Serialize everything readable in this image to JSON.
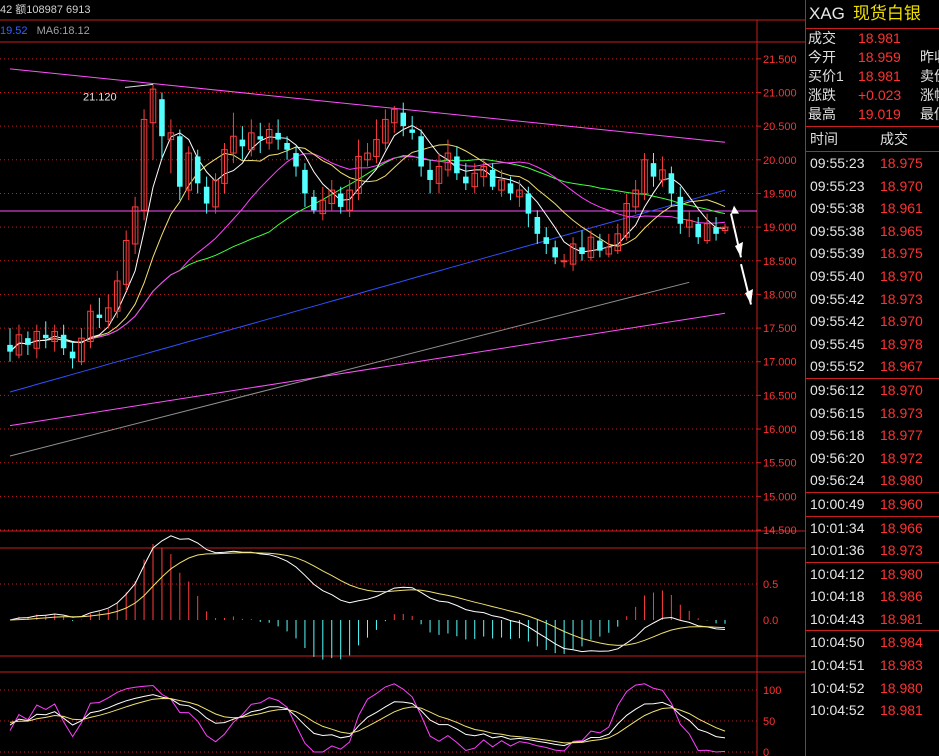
{
  "header": {
    "volume_text": "42 额108987 6913",
    "ma_value": "19.52",
    "ma6_text": "MA6:18.12"
  },
  "chart_data": {
    "type": "candlestick",
    "annotation": "21.120",
    "price_axis": {
      "ylim": [
        14.5,
        21.75
      ],
      "ticks": [
        "21.500",
        "21.000",
        "20.500",
        "20.000",
        "19.500",
        "19.000",
        "18.500",
        "18.000",
        "17.500",
        "17.000",
        "16.500",
        "16.000",
        "15.500",
        "15.000",
        "14.500"
      ]
    },
    "macd_axis": {
      "ticks": [
        "0.5",
        "0.0"
      ]
    },
    "kdj_axis": {
      "ticks": [
        "100",
        "50",
        "0"
      ]
    },
    "current_level": 19.24,
    "candles": [
      [
        17.25,
        17.15,
        17.5,
        17.0
      ],
      [
        17.1,
        17.4,
        17.55,
        17.05
      ],
      [
        17.35,
        17.25,
        17.45,
        17.1
      ],
      [
        17.2,
        17.45,
        17.55,
        17.05
      ],
      [
        17.4,
        17.35,
        17.6,
        17.2
      ],
      [
        17.3,
        17.45,
        17.55,
        17.15
      ],
      [
        17.4,
        17.2,
        17.55,
        17.1
      ],
      [
        17.15,
        17.05,
        17.3,
        16.9
      ],
      [
        17.0,
        17.35,
        17.5,
        16.95
      ],
      [
        17.3,
        17.75,
        17.85,
        17.2
      ],
      [
        17.7,
        17.65,
        17.95,
        17.5
      ],
      [
        17.6,
        17.8,
        18.0,
        17.5
      ],
      [
        17.75,
        18.2,
        18.35,
        17.65
      ],
      [
        18.15,
        18.8,
        18.95,
        18.05
      ],
      [
        18.75,
        19.3,
        19.45,
        18.6
      ],
      [
        19.25,
        20.6,
        20.75,
        19.1
      ],
      [
        20.55,
        21.05,
        21.12,
        20.0
      ],
      [
        20.9,
        20.35,
        21.0,
        20.0
      ],
      [
        20.3,
        20.4,
        20.6,
        19.8
      ],
      [
        20.35,
        19.6,
        20.45,
        19.4
      ],
      [
        19.55,
        20.1,
        20.2,
        19.4
      ],
      [
        20.05,
        19.65,
        20.15,
        19.5
      ],
      [
        19.6,
        19.35,
        19.75,
        19.2
      ],
      [
        19.3,
        19.7,
        19.8,
        19.2
      ],
      [
        19.65,
        20.15,
        20.25,
        19.5
      ],
      [
        20.1,
        20.35,
        20.7,
        19.95
      ],
      [
        20.3,
        20.2,
        20.5,
        20.0
      ],
      [
        20.15,
        20.4,
        20.6,
        20.05
      ],
      [
        20.35,
        20.3,
        20.55,
        20.1
      ],
      [
        20.25,
        20.45,
        20.55,
        20.15
      ],
      [
        20.4,
        20.3,
        20.6,
        20.15
      ],
      [
        20.25,
        20.15,
        20.35,
        20.0
      ],
      [
        20.1,
        19.9,
        20.2,
        19.75
      ],
      [
        19.85,
        19.5,
        19.95,
        19.3
      ],
      [
        19.45,
        19.25,
        19.55,
        19.2
      ],
      [
        19.2,
        19.4,
        19.6,
        19.1
      ],
      [
        19.35,
        19.55,
        19.7,
        19.25
      ],
      [
        19.5,
        19.3,
        19.6,
        19.2
      ],
      [
        19.25,
        19.55,
        19.7,
        19.15
      ],
      [
        19.5,
        20.05,
        20.3,
        19.4
      ],
      [
        20.0,
        20.1,
        20.25,
        19.9
      ],
      [
        20.05,
        20.3,
        20.6,
        19.95
      ],
      [
        20.25,
        20.6,
        20.75,
        20.15
      ],
      [
        20.55,
        20.75,
        20.8,
        20.4
      ],
      [
        20.7,
        20.5,
        20.85,
        20.35
      ],
      [
        20.45,
        20.4,
        20.65,
        20.3
      ],
      [
        20.35,
        19.9,
        20.45,
        19.75
      ],
      [
        19.85,
        19.7,
        20.0,
        19.5
      ],
      [
        19.65,
        19.9,
        20.1,
        19.5
      ],
      [
        19.85,
        20.1,
        20.3,
        19.75
      ],
      [
        20.05,
        19.8,
        20.2,
        19.7
      ],
      [
        19.75,
        19.65,
        19.95,
        19.55
      ],
      [
        19.6,
        19.8,
        19.95,
        19.5
      ],
      [
        19.75,
        19.9,
        20.0,
        19.6
      ],
      [
        19.85,
        19.6,
        19.95,
        19.55
      ],
      [
        19.55,
        19.7,
        19.85,
        19.45
      ],
      [
        19.65,
        19.5,
        19.75,
        19.4
      ],
      [
        19.45,
        19.55,
        19.7,
        19.3
      ],
      [
        19.5,
        19.2,
        19.6,
        19.0
      ],
      [
        19.15,
        18.9,
        19.25,
        18.75
      ],
      [
        18.85,
        18.75,
        19.0,
        18.6
      ],
      [
        18.7,
        18.55,
        18.8,
        18.45
      ],
      [
        18.5,
        18.5,
        18.6,
        18.4
      ],
      [
        18.45,
        18.75,
        18.85,
        18.35
      ],
      [
        18.7,
        18.6,
        18.95,
        18.5
      ],
      [
        18.55,
        18.85,
        18.95,
        18.5
      ],
      [
        18.8,
        18.65,
        18.9,
        18.55
      ],
      [
        18.6,
        18.7,
        18.9,
        18.55
      ],
      [
        18.65,
        18.9,
        19.05,
        18.6
      ],
      [
        18.85,
        19.35,
        19.5,
        18.8
      ],
      [
        19.3,
        19.55,
        19.7,
        19.2
      ],
      [
        19.5,
        20.0,
        20.1,
        19.4
      ],
      [
        19.95,
        19.75,
        20.1,
        19.6
      ],
      [
        19.7,
        19.85,
        20.05,
        19.6
      ],
      [
        19.8,
        19.5,
        19.9,
        19.3
      ],
      [
        19.45,
        19.05,
        19.6,
        18.9
      ],
      [
        19.0,
        19.1,
        19.25,
        18.85
      ],
      [
        19.05,
        18.85,
        19.15,
        18.75
      ],
      [
        18.8,
        19.05,
        19.2,
        18.75
      ],
      [
        19.0,
        18.9,
        19.15,
        18.8
      ],
      [
        18.95,
        19.0,
        19.05,
        18.9
      ]
    ],
    "trendlines": [
      {
        "name": "resistance",
        "points": [
          [
            0,
            21.35
          ],
          [
            80,
            20.26
          ]
        ]
      },
      {
        "name": "support",
        "points": [
          [
            0,
            16.05
          ],
          [
            80,
            17.72
          ]
        ]
      },
      {
        "name": "long-ma",
        "points": [
          [
            0,
            15.6
          ],
          [
            76,
            18.18
          ]
        ]
      }
    ]
  },
  "quote_panel": {
    "symbol": "XAG",
    "name": "现货白银",
    "rows": [
      {
        "label": "成交",
        "value": "18.981",
        "label2": ""
      },
      {
        "label": "今开",
        "value": "18.959",
        "label2": "昨收"
      },
      {
        "label": "买价1",
        "value": "18.981",
        "label2": "卖价"
      },
      {
        "label": "涨跌",
        "value": "+0.023",
        "label2": "涨幅"
      },
      {
        "label": "最高",
        "value": "19.019",
        "label2": "最低"
      }
    ],
    "tick_header": {
      "time": "时间",
      "price": "成交"
    },
    "ticks": [
      {
        "time": "09:55:23",
        "price": "18.975",
        "sep": false
      },
      {
        "time": "09:55:23",
        "price": "18.970",
        "sep": false
      },
      {
        "time": "09:55:38",
        "price": "18.961",
        "sep": false
      },
      {
        "time": "09:55:38",
        "price": "18.965",
        "sep": false
      },
      {
        "time": "09:55:39",
        "price": "18.975",
        "sep": false
      },
      {
        "time": "09:55:40",
        "price": "18.970",
        "sep": false
      },
      {
        "time": "09:55:42",
        "price": "18.973",
        "sep": false
      },
      {
        "time": "09:55:42",
        "price": "18.970",
        "sep": false
      },
      {
        "time": "09:55:45",
        "price": "18.978",
        "sep": false
      },
      {
        "time": "09:55:52",
        "price": "18.967",
        "sep": false
      },
      {
        "time": "09:56:12",
        "price": "18.970",
        "sep": true
      },
      {
        "time": "09:56:15",
        "price": "18.973",
        "sep": false
      },
      {
        "time": "09:56:18",
        "price": "18.977",
        "sep": false
      },
      {
        "time": "09:56:20",
        "price": "18.972",
        "sep": false
      },
      {
        "time": "09:56:24",
        "price": "18.980",
        "sep": false
      },
      {
        "time": "10:00:49",
        "price": "18.960",
        "sep": true
      },
      {
        "time": "10:01:34",
        "price": "18.966",
        "sep": true
      },
      {
        "time": "10:01:36",
        "price": "18.973",
        "sep": false
      },
      {
        "time": "10:04:12",
        "price": "18.980",
        "sep": true
      },
      {
        "time": "10:04:18",
        "price": "18.986",
        "sep": false
      },
      {
        "time": "10:04:43",
        "price": "18.981",
        "sep": false
      },
      {
        "time": "10:04:50",
        "price": "18.984",
        "sep": true
      },
      {
        "time": "10:04:51",
        "price": "18.983",
        "sep": false
      },
      {
        "time": "10:04:52",
        "price": "18.980",
        "sep": false
      },
      {
        "time": "10:04:52",
        "price": "18.981",
        "sep": false
      }
    ]
  },
  "colors": {
    "up": "#ff3c3c",
    "down": "#54ffff",
    "grid": "#c81e1e",
    "bg": "#000000",
    "ma5": "#ffffff",
    "ma10": "#f0e070",
    "ma20": "#ff40ff",
    "ma30": "#40ff40",
    "ma60": "#3050ff",
    "ma120": "#909090",
    "trend": "#ff50ff",
    "axis_text": "#ff3232"
  }
}
